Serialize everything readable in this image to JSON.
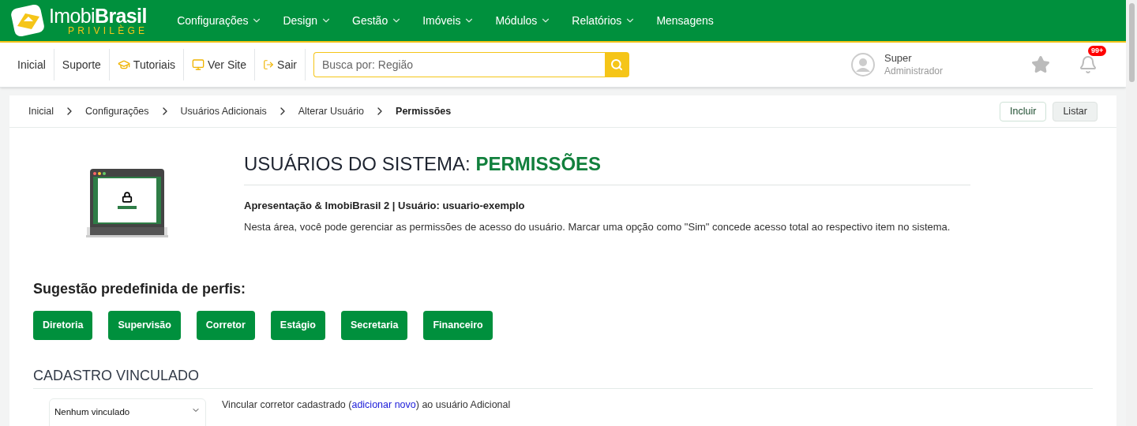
{
  "logo": {
    "brand_light": "Imobi",
    "brand_bold": "Brasil",
    "tagline": "PRIVILÈGE"
  },
  "top_menu": [
    {
      "label": "Configurações",
      "dropdown": true
    },
    {
      "label": "Design",
      "dropdown": true
    },
    {
      "label": "Gestão",
      "dropdown": true
    },
    {
      "label": "Imóveis",
      "dropdown": true
    },
    {
      "label": "Módulos",
      "dropdown": true
    },
    {
      "label": "Relatórios",
      "dropdown": true
    },
    {
      "label": "Mensagens",
      "dropdown": false
    }
  ],
  "toolbar_links": [
    {
      "label": "Inicial",
      "kind": "plain"
    },
    {
      "label": "Suporte",
      "kind": "plain"
    },
    {
      "label": "Tutoriais",
      "kind": "tutorials"
    },
    {
      "label": "Ver Site",
      "kind": "site"
    },
    {
      "label": "Sair",
      "kind": "logout"
    }
  ],
  "search": {
    "placeholder": "Busca por: Região"
  },
  "user": {
    "name": "Super",
    "role": "Administrador"
  },
  "notifications": {
    "badge": "99+"
  },
  "breadcrumb": [
    {
      "label": "Inicial",
      "current": false
    },
    {
      "label": "Configurações",
      "current": false
    },
    {
      "label": "Usuários Adicionais",
      "current": false
    },
    {
      "label": "Alterar Usuário",
      "current": false
    },
    {
      "label": "Permissões",
      "current": true
    }
  ],
  "actions": [
    {
      "label": "Incluir",
      "kind": "outline"
    },
    {
      "label": "Listar",
      "kind": "filled"
    }
  ],
  "header": {
    "title": "USUÁRIOS DO SISTEMA:",
    "title_highlight": "PERMISSÕES",
    "subtitle": "Apresentação & ImobiBrasil 2 | Usuário: usuario-exemplo",
    "description": "Nesta área, você pode gerenciar as permissões de acesso do usuário. Marcar uma opção como \"Sim\" concede acesso total ao respectivo item no sistema."
  },
  "profiles": {
    "heading": "Sugestão predefinida de perfis:",
    "buttons": [
      "Diretoria",
      "Supervisão",
      "Corretor",
      "Estágio",
      "Secretaria",
      "Financeiro"
    ]
  },
  "linked": {
    "heading": "CADASTRO VINCULADO",
    "select_value": "Nenhum vinculado",
    "text_before": "Vincular corretor cadastrado (",
    "link": "adicionar novo",
    "text_after": ") ao usuário Adicional"
  }
}
